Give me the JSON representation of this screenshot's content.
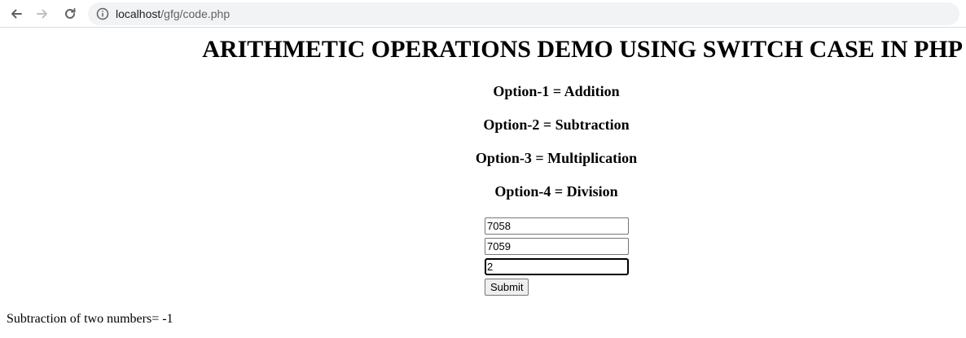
{
  "browser": {
    "url_host": "localhost",
    "url_path": "/gfg/code.php",
    "icons": {
      "back": "arrow-left-icon",
      "forward": "arrow-right-icon",
      "reload": "reload-icon",
      "info": "info-icon"
    }
  },
  "page": {
    "title": "ARITHMETIC OPERATIONS DEMO USING SWITCH CASE IN PHP",
    "options": [
      "Option-1 = Addition",
      "Option-2 = Subtraction",
      "Option-3 = Multiplication",
      "Option-4 = Division"
    ],
    "inputs": {
      "first_number": "7058",
      "second_number": "7059",
      "option": "2"
    },
    "submit_label": "Submit",
    "result": "Subtraction of two numbers= -1"
  }
}
